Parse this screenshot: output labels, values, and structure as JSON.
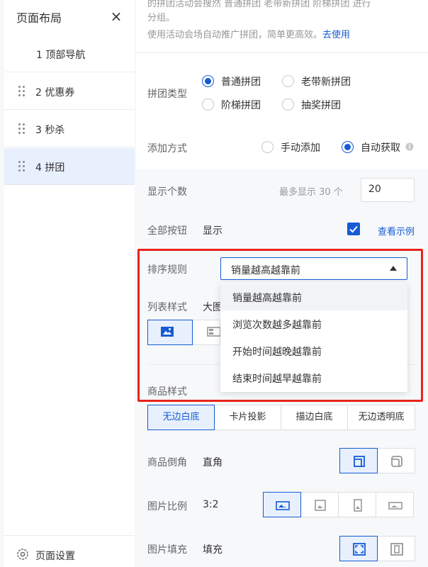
{
  "sidebar": {
    "title": "页面布局",
    "close_icon": "×",
    "items": [
      {
        "label": "1 顶部导航",
        "draggable": false,
        "active": false
      },
      {
        "label": "2 优惠券",
        "draggable": true,
        "active": false
      },
      {
        "label": "3 秒杀",
        "draggable": true,
        "active": false
      },
      {
        "label": "4 拼团",
        "draggable": true,
        "active": true
      }
    ],
    "footer_label": "页面设置"
  },
  "intro": {
    "line1": "的拼团活动会搜然 普通拼团 老带新拼团 阶梯拼团 进行",
    "line2": "分组。",
    "line3": "使用活动会场自动推广拼团，简单更高效。",
    "link": "去使用"
  },
  "group_type": {
    "label": "拼团类型",
    "options": [
      "普通拼团",
      "老带新拼团",
      "阶梯拼团",
      "抽奖拼团"
    ],
    "selected": "普通拼团"
  },
  "add_method": {
    "label": "添加方式",
    "options": [
      "手动添加",
      "自动获取"
    ],
    "selected": "自动获取"
  },
  "display_count": {
    "label": "显示个数",
    "hint": "最多显示 30 个",
    "value": "20"
  },
  "all_button": {
    "label": "全部按钮",
    "value": "显示",
    "checked": true,
    "link": "查看示例"
  },
  "sort_rule": {
    "label": "排序规则",
    "selected": "销量越高越靠前",
    "options": [
      "销量越高越靠前",
      "浏览次数越多越靠前",
      "开始时间越晚越靠前",
      "结束时间越早越靠前"
    ]
  },
  "list_style": {
    "label": "列表样式",
    "value": "大图"
  },
  "goods_style": {
    "label": "商品样式",
    "options": [
      "无边白底",
      "卡片投影",
      "描边白底",
      "无边透明底"
    ],
    "selected": "无边白底"
  },
  "goods_corner": {
    "label": "商品倒角",
    "value": "直角"
  },
  "image_ratio": {
    "label": "图片比例",
    "value": "3:2"
  },
  "image_fill": {
    "label": "图片填充",
    "value": "填充"
  },
  "colors": {
    "primary": "#155bd4",
    "highlight_frame": "#e8241b",
    "active_bg": "#e8f0fe"
  }
}
